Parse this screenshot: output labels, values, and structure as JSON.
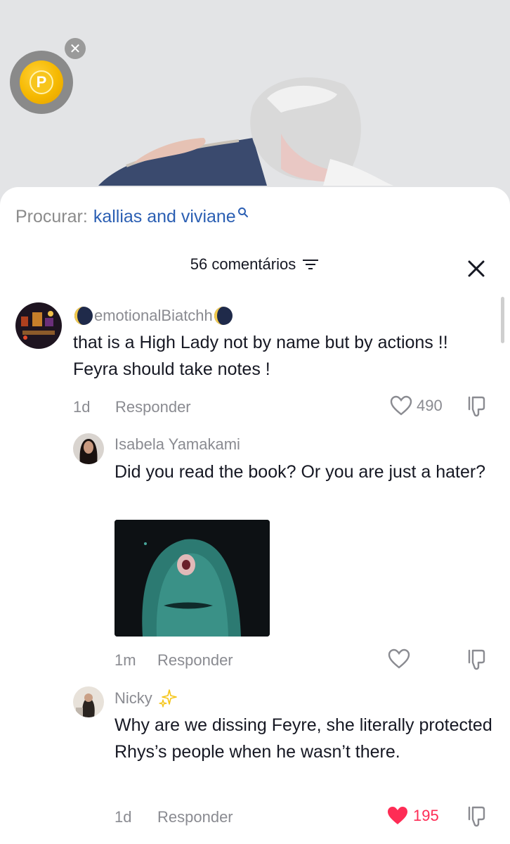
{
  "search": {
    "prefix": "Procurar:",
    "query": "kallias and viviane"
  },
  "comments_header": {
    "count_label": "56 comentários"
  },
  "comments": [
    {
      "username": "emotionalBiatchh",
      "text": "that is a High Lady not by name but by actions !! Feyra should take notes !",
      "time": "1d",
      "reply_label": "Responder",
      "likes": "490",
      "liked": false
    },
    {
      "username": "Isabela Yamakami",
      "text": "Did you read the book? Or you are just a hater?",
      "time": "1m",
      "reply_label": "Responder",
      "likes": "",
      "liked": false
    },
    {
      "username": "Nicky",
      "text": "Why are we dissing Feyre, she literally protected Rhys’s people when he wasn’t there.",
      "time": "1d",
      "reply_label": "Responder",
      "likes": "195",
      "liked": true
    }
  ],
  "colors": {
    "link": "#2b5fb3",
    "liked_heart": "#fe2c55",
    "muted_text": "#8a8b91",
    "coin": "#f5b800"
  }
}
